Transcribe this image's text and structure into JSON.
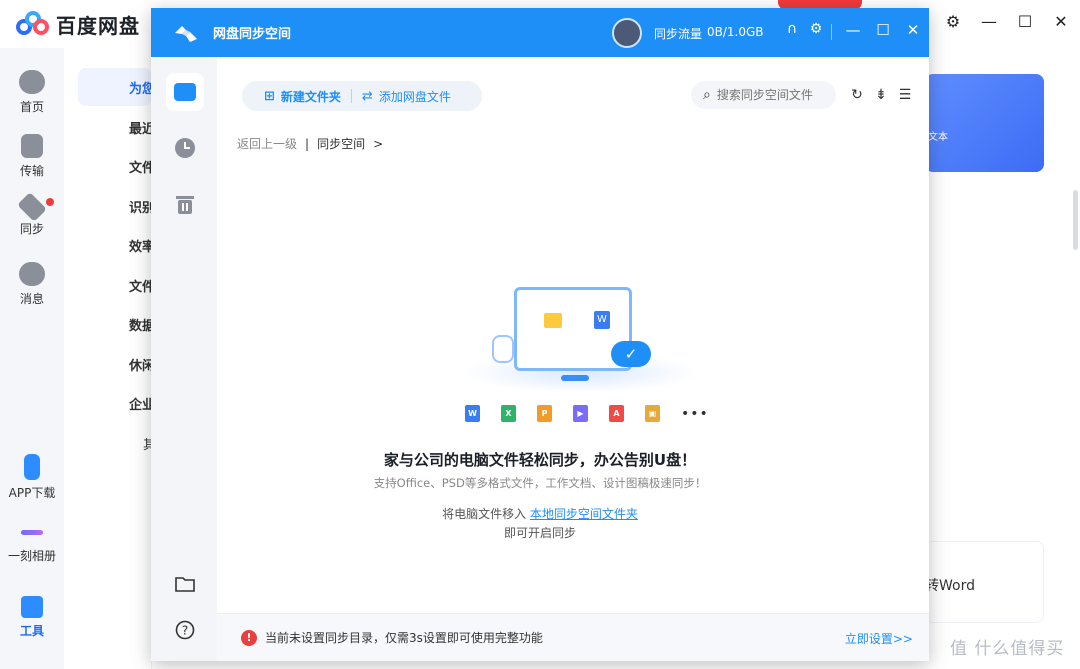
{
  "background_app": {
    "logo_text": "百度网盘",
    "window_controls": [
      "⊡",
      "⚙",
      "—",
      "☐",
      "✕"
    ],
    "left_nav": [
      {
        "label": "首页",
        "icon": "cloud-icon"
      },
      {
        "label": "传输",
        "icon": "transfer-icon"
      },
      {
        "label": "同步",
        "icon": "sync-icon"
      },
      {
        "label": "消息",
        "icon": "people-icon"
      },
      {
        "label": "APP下载",
        "icon": "phone-icon"
      },
      {
        "label": "一刻相册",
        "icon": "album-icon"
      },
      {
        "label": "工具",
        "icon": "tools-icon"
      }
    ],
    "sub_nav": [
      "为您",
      "最近",
      "文件",
      "识别",
      "效率",
      "文件",
      "数据",
      "休闲",
      "企业",
      "其"
    ],
    "card_text": "文本",
    "card2_text": "转Word",
    "watermark": "值 什么值得买"
  },
  "sync_window": {
    "title": "网盘同步空间",
    "traffic_label": "同步流量",
    "traffic_value": "0B/1.0GB",
    "title_icons": [
      "headset-icon",
      "settings-icon"
    ],
    "window_controls": {
      "minimize": "—",
      "maximize": "☐",
      "close": "✕"
    },
    "sidebar": [
      {
        "name": "files",
        "icon": "folder-file-icon"
      },
      {
        "name": "history",
        "icon": "clock-icon"
      },
      {
        "name": "trash",
        "icon": "trash-icon"
      },
      {
        "name": "open-folder",
        "icon": "folder-icon"
      },
      {
        "name": "help",
        "icon": "help-icon"
      }
    ],
    "toolbar": {
      "new_folder": "新建文件夹",
      "add_cloud_file": "添加网盘文件",
      "search_placeholder": "搜索同步空间文件"
    },
    "breadcrumb": {
      "back": "返回上一级",
      "separator": "|",
      "current": "同步空间",
      "arrow": ">"
    },
    "file_types": [
      {
        "name": "word",
        "label": "W",
        "color": "#3a7cf3"
      },
      {
        "name": "excel",
        "label": "X",
        "color": "#2fb36a"
      },
      {
        "name": "ppt",
        "label": "P",
        "color": "#f39a2c"
      },
      {
        "name": "video",
        "label": "▶",
        "color": "#7b6cf6"
      },
      {
        "name": "pdf",
        "label": "A",
        "color": "#ef4b48"
      },
      {
        "name": "image",
        "label": "▣",
        "color": "#e6a93a"
      }
    ],
    "file_more": "•••",
    "empty_state": {
      "headline": "家与公司的电脑文件轻松同步，办公告别U盘！",
      "subline": "支持Office、PSD等多格式文件，工作文档、设计图稿极速同步！",
      "hint_prefix": "将电脑文件移入",
      "hint_link": "本地同步空间文件夹",
      "hint_suffix": "即可开启同步"
    },
    "notice": {
      "icon": "!",
      "text": "当前未设置同步目录，仅需3s设置即可使用完整功能",
      "link": "立即设置>>"
    }
  }
}
